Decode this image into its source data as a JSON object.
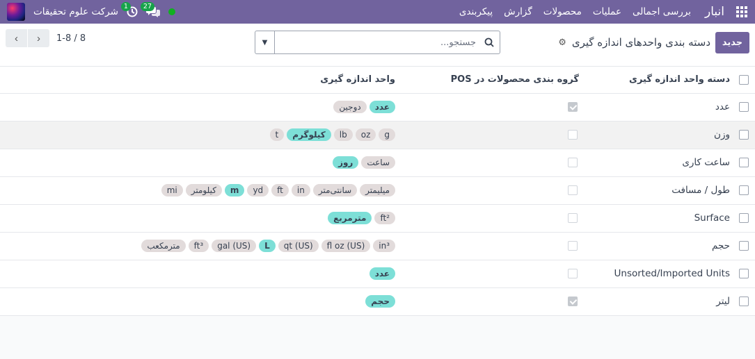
{
  "navbar": {
    "app_name": "انبار",
    "menu": [
      "بررسی اجمالی",
      "عملیات",
      "محصولات",
      "گزارش",
      "پیکربندی"
    ],
    "company_name": "شرکت علوم تحقیقات",
    "chat_count": "27",
    "activity_count": "1",
    "bg_color": "#71639e"
  },
  "control": {
    "new_label": "جدید",
    "breadcrumb": "دسته بندی واحدهای اندازه گیری",
    "search_placeholder": "جستجو...",
    "pager_value": "1-8 / 8"
  },
  "table": {
    "headers": {
      "name": "دسته واحد اندازه گیری",
      "pos": "گروه بندی محصولات در POS",
      "uom": "واحد اندازه گیری"
    },
    "rows": [
      {
        "name": "عدد",
        "pos_checked": true,
        "tags": [
          {
            "t": "عدد",
            "ref": true
          },
          {
            "t": "دوجین",
            "ref": false
          }
        ]
      },
      {
        "name": "وزن",
        "pos_checked": false,
        "tags": [
          {
            "t": "g",
            "ref": false
          },
          {
            "t": "oz",
            "ref": false
          },
          {
            "t": "lb",
            "ref": false
          },
          {
            "t": "کیلوگرم",
            "ref": true
          },
          {
            "t": "t",
            "ref": false
          }
        ]
      },
      {
        "name": "ساعت کاری",
        "pos_checked": false,
        "tags": [
          {
            "t": "ساعت",
            "ref": false
          },
          {
            "t": "روز",
            "ref": true
          }
        ]
      },
      {
        "name": "طول / مسافت",
        "pos_checked": false,
        "tags": [
          {
            "t": "میلیمتر",
            "ref": false
          },
          {
            "t": "سانتی‌متر",
            "ref": false
          },
          {
            "t": "in",
            "ref": false
          },
          {
            "t": "ft",
            "ref": false
          },
          {
            "t": "yd",
            "ref": false
          },
          {
            "t": "m",
            "ref": true
          },
          {
            "t": "کیلومتر",
            "ref": false
          },
          {
            "t": "mi",
            "ref": false
          }
        ]
      },
      {
        "name": "Surface",
        "pos_checked": false,
        "tags": [
          {
            "t": "ft²",
            "ref": false
          },
          {
            "t": "مترمربع",
            "ref": true
          }
        ]
      },
      {
        "name": "حجم",
        "pos_checked": false,
        "tags": [
          {
            "t": "in³",
            "ref": false
          },
          {
            "t": "fl oz (US)",
            "ref": false
          },
          {
            "t": "qt (US)",
            "ref": false
          },
          {
            "t": "L",
            "ref": true
          },
          {
            "t": "gal (US)",
            "ref": false
          },
          {
            "t": "ft³",
            "ref": false
          },
          {
            "t": "مترمکعب",
            "ref": false
          }
        ]
      },
      {
        "name": "Unsorted/Imported Units",
        "pos_checked": false,
        "tags": [
          {
            "t": "عدد",
            "ref": true
          }
        ]
      },
      {
        "name": "لیتر",
        "pos_checked": true,
        "tags": [
          {
            "t": "حجم",
            "ref": true
          }
        ]
      }
    ]
  }
}
